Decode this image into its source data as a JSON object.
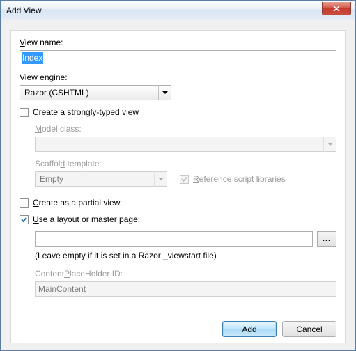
{
  "window": {
    "title": "Add View"
  },
  "viewName": {
    "label": "View name:",
    "value": "Index"
  },
  "viewEngine": {
    "label": "View engine:",
    "value": "Razor (CSHTML)"
  },
  "stronglyTyped": {
    "label": "Create a strongly-typed view",
    "checked": false,
    "modelClass": {
      "label": "Model class:",
      "value": ""
    },
    "scaffold": {
      "label": "Scaffold template:",
      "value": "Empty"
    },
    "referenceScripts": {
      "label": "Reference script libraries",
      "checked": true
    }
  },
  "partialView": {
    "label": "Create as a partial view",
    "checked": false
  },
  "layout": {
    "label": "Use a layout or master page:",
    "checked": true,
    "path": "",
    "browse": "...",
    "hint": "(Leave empty if it is set in a Razor _viewstart file)",
    "cphLabel": "ContentPlaceHolder ID:",
    "cphValue": "MainContent"
  },
  "buttons": {
    "add": "Add",
    "cancel": "Cancel"
  }
}
